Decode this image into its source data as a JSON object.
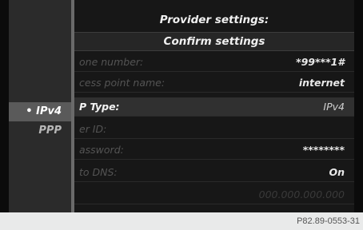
{
  "left_options": [
    {
      "label": "• IPv4",
      "selected": true
    },
    {
      "label": "PPP",
      "selected": false
    }
  ],
  "panel": {
    "title": "Provider settings:",
    "confirm_label": "Confirm settings",
    "rows": [
      {
        "label": "one number:",
        "value": "*99***1#"
      },
      {
        "label": "cess point name:",
        "value": "internet"
      },
      {
        "label": "P Type:",
        "value": "IPv4"
      },
      {
        "label": "er ID:",
        "value": ""
      },
      {
        "label": "assword:",
        "value": "********"
      },
      {
        "label": "to DNS:",
        "value": "On"
      },
      {
        "label": "",
        "value": "000.000.000.000"
      }
    ]
  },
  "figure_ref": "P82.89-0553-31",
  "colors": {
    "screen_bg": "#0b0b0b",
    "panel_bg": "#171717",
    "selected_bg": "#303030",
    "page_bg": "#e9eaea"
  }
}
